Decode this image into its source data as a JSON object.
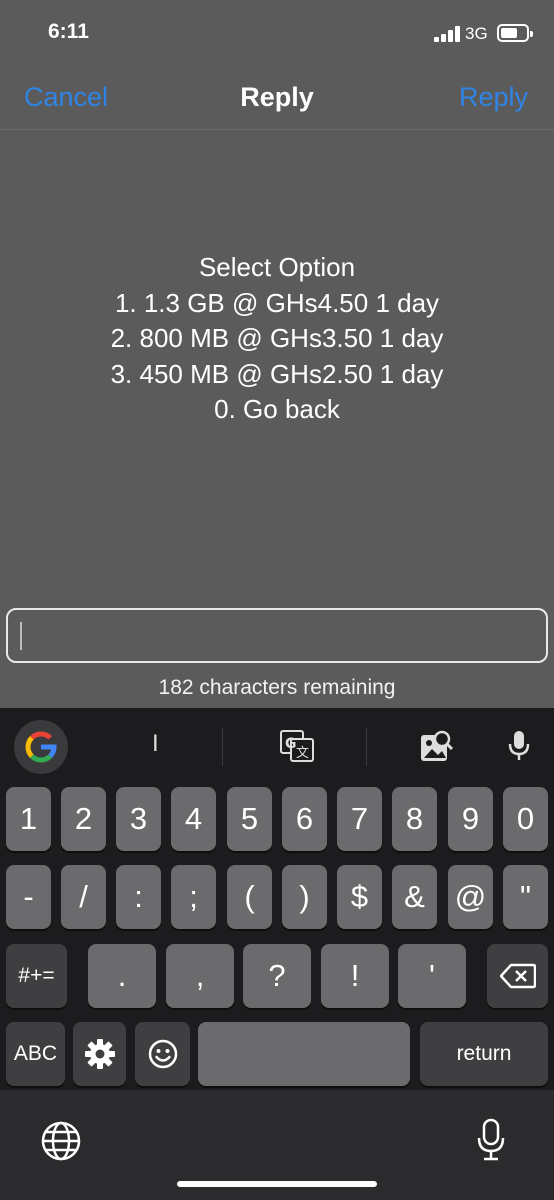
{
  "status_bar": {
    "time": "6:11",
    "network": "3G"
  },
  "nav": {
    "cancel_label": "Cancel",
    "title": "Reply",
    "reply_label": "Reply"
  },
  "message": {
    "lines": [
      "Select Option",
      "1. 1.3 GB @ GHs4.50 1 day",
      "2. 800 MB @ GHs3.50 1 day",
      "3. 450 MB @ GHs2.50 1 day",
      "0. Go back"
    ]
  },
  "reply_input": {
    "value": "",
    "remaining": "182 characters remaining"
  },
  "keyboard": {
    "suggestion": "I",
    "row1": [
      "1",
      "2",
      "3",
      "4",
      "5",
      "6",
      "7",
      "8",
      "9",
      "0"
    ],
    "row2": [
      "-",
      "/",
      ":",
      ";",
      "(",
      ")",
      "$",
      "&",
      "@",
      "\""
    ],
    "row3": [
      ".",
      ",",
      "?",
      "!",
      "'"
    ],
    "symbols_label": "#+=",
    "abc_label": "ABC",
    "return_label": "return",
    "icons": {
      "google": "google-icon",
      "translate": "translate-icon",
      "image_search": "image-search-icon",
      "mic": "mic-icon",
      "backspace": "backspace-icon",
      "settings": "gear-icon",
      "emoji": "emoji-icon",
      "globe": "globe-icon"
    }
  }
}
